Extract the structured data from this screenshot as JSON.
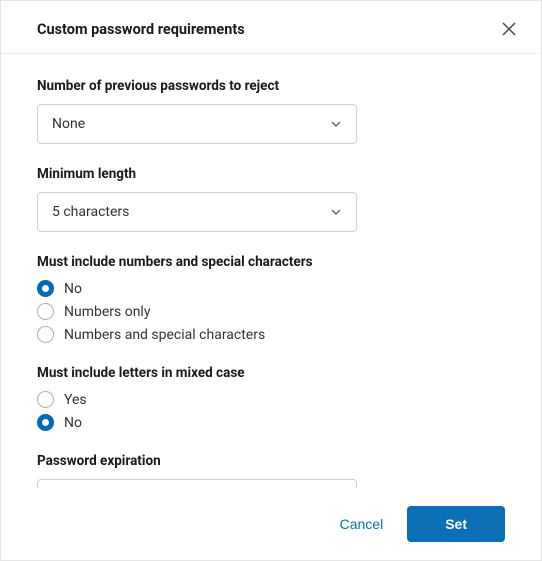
{
  "dialog": {
    "title": "Custom password requirements"
  },
  "fields": {
    "previousPasswords": {
      "label": "Number of previous passwords to reject",
      "value": "None"
    },
    "minLength": {
      "label": "Minimum length",
      "value": "5 characters"
    },
    "numbersSpecial": {
      "label": "Must include numbers and special characters",
      "options": {
        "no": "No",
        "numbersOnly": "Numbers only",
        "numbersAndSpecial": "Numbers and special characters"
      }
    },
    "mixedCase": {
      "label": "Must include letters in mixed case",
      "options": {
        "yes": "Yes",
        "no": "No"
      }
    },
    "expiration": {
      "label": "Password expiration",
      "value": ""
    }
  },
  "footer": {
    "cancel": "Cancel",
    "set": "Set"
  }
}
